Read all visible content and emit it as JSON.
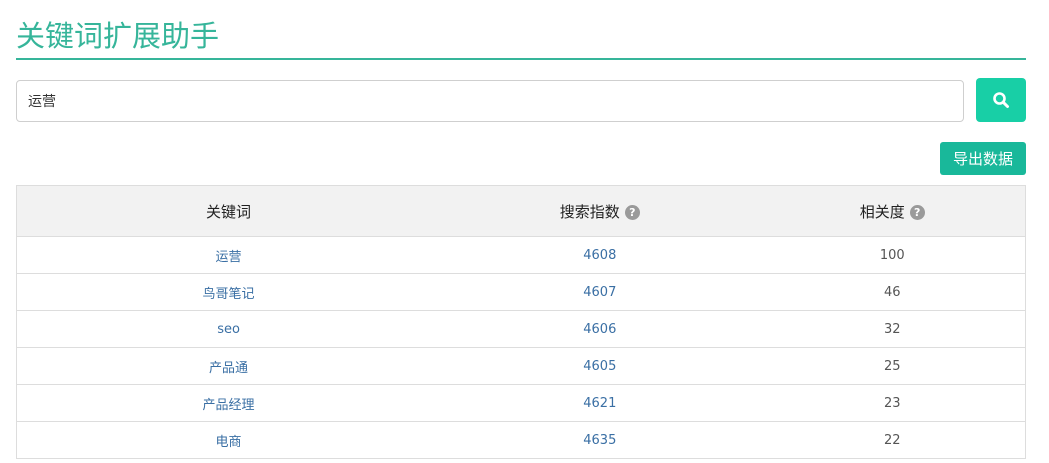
{
  "app": {
    "title": "关键词扩展助手"
  },
  "search": {
    "value": "运营",
    "button_icon": "search-icon",
    "accent": "#18cfa6"
  },
  "toolbar": {
    "export_label": "导出数据"
  },
  "table": {
    "headers": {
      "keyword": "关键词",
      "search_index": "搜索指数",
      "relevance": "相关度"
    },
    "help_icon": "help-icon",
    "rows": [
      {
        "keyword": "运营",
        "search_index": "4608",
        "relevance": "100"
      },
      {
        "keyword": "鸟哥笔记",
        "search_index": "4607",
        "relevance": "46"
      },
      {
        "keyword": "seo",
        "search_index": "4606",
        "relevance": "32"
      },
      {
        "keyword": "产品通",
        "search_index": "4605",
        "relevance": "25"
      },
      {
        "keyword": "产品经理",
        "search_index": "4621",
        "relevance": "23"
      },
      {
        "keyword": "电商",
        "search_index": "4635",
        "relevance": "22"
      }
    ]
  },
  "colors": {
    "title": "#36b59a",
    "export_button": "#19b89a",
    "link": "#3a6fa4"
  }
}
